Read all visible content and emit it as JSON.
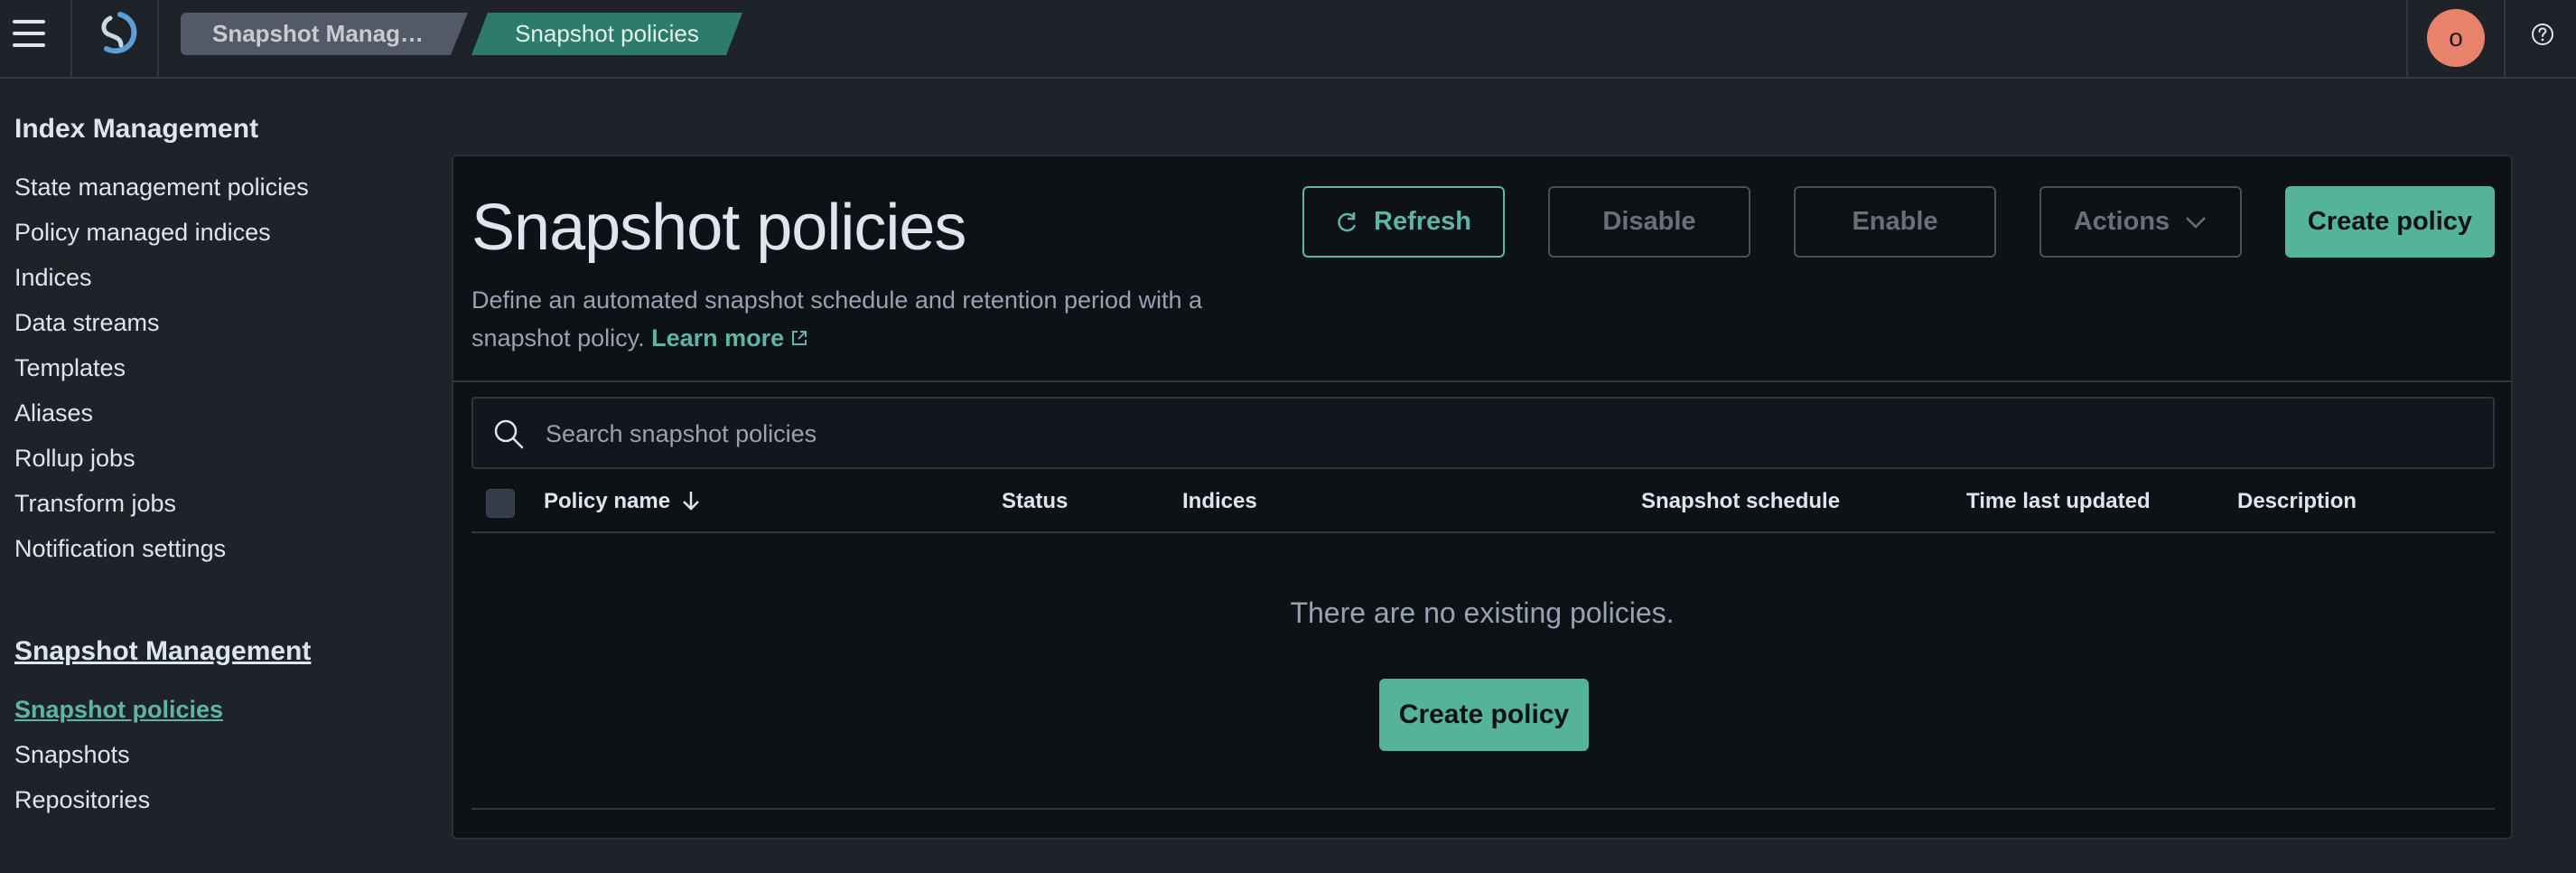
{
  "header": {
    "breadcrumbs": [
      "Snapshot Manag…",
      "Snapshot policies"
    ],
    "avatar_initial": "o",
    "icons": [
      "hamburger-icon",
      "app-logo",
      "help-icon"
    ]
  },
  "sidebar": {
    "section1_title": "Index Management",
    "section1_items": [
      "State management policies",
      "Policy managed indices",
      "Indices",
      "Data streams",
      "Templates",
      "Aliases",
      "Rollup jobs",
      "Transform jobs",
      "Notification settings"
    ],
    "section2_title": "Snapshot Management",
    "section2_items": [
      "Snapshot policies",
      "Snapshots",
      "Repositories"
    ],
    "active_item": "Snapshot policies"
  },
  "main": {
    "title": "Snapshot policies",
    "description": "Define an automated snapshot schedule and retention period with a snapshot policy.",
    "learn_more": "Learn more",
    "buttons": {
      "refresh": "Refresh",
      "disable": "Disable",
      "enable": "Enable",
      "actions": "Actions",
      "create": "Create policy"
    },
    "search_placeholder": "Search snapshot policies",
    "table_headers": [
      "Policy name",
      "Status",
      "Indices",
      "Snapshot schedule",
      "Time last updated",
      "Description"
    ],
    "empty_message": "There are no existing policies.",
    "empty_create": "Create policy"
  },
  "colors": {
    "accent": "#54b399",
    "link": "#5fb5a4",
    "avatar": "#e8826a",
    "background": "#1d2329",
    "panel": "#0e1116"
  }
}
